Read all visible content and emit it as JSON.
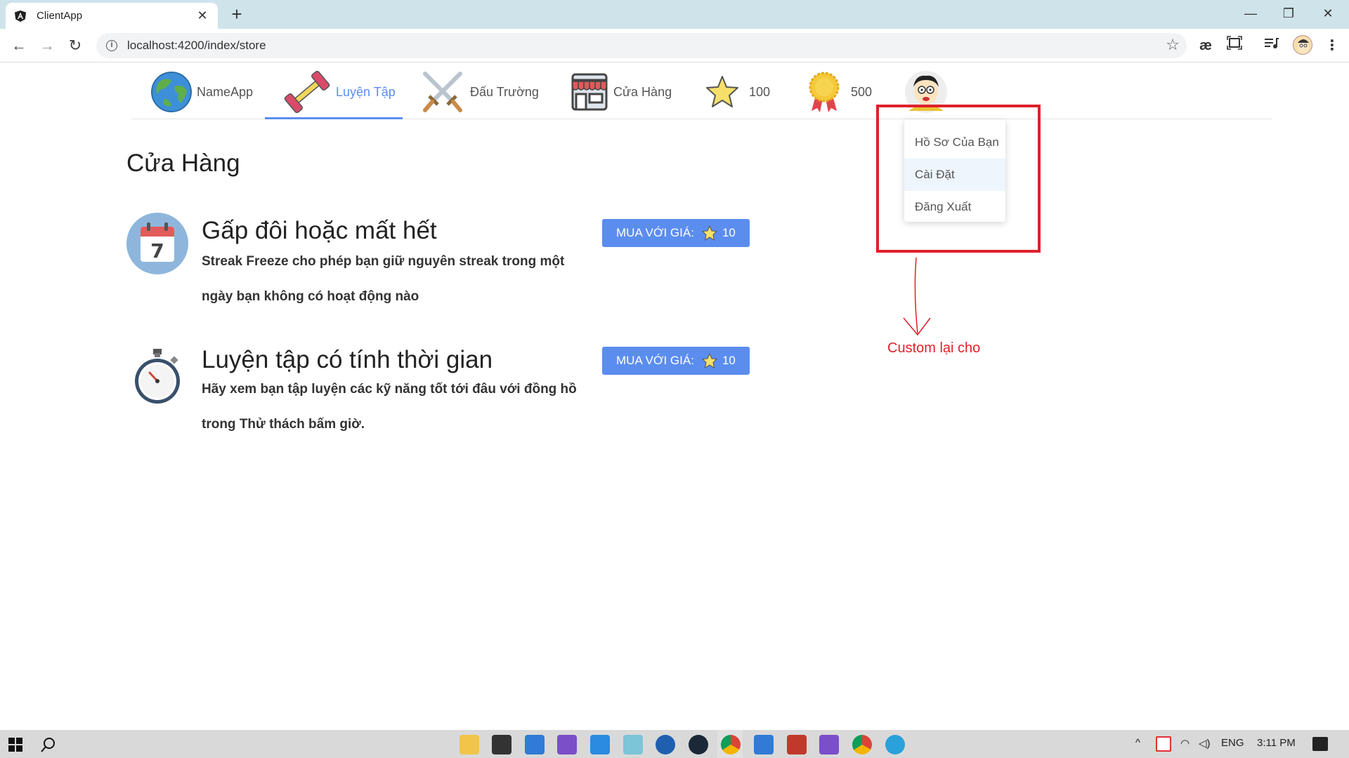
{
  "browser": {
    "tab_title": "ClientApp",
    "tab_close": "✕",
    "new_tab": "+",
    "url": "localhost:4200/index/store",
    "win_min": "—",
    "win_max": "❐",
    "win_close": "✕",
    "back": "←",
    "forward": "→",
    "reload": "↻",
    "star": "☆",
    "ext_text": "æ"
  },
  "nav": {
    "items": [
      {
        "label": "NameApp",
        "icon": "globe-icon"
      },
      {
        "label": "Luyện Tập",
        "icon": "dumbbell-icon",
        "active": true
      },
      {
        "label": "Đấu Trường",
        "icon": "crossed-swords-icon"
      },
      {
        "label": "Cửa Hàng",
        "icon": "store-icon"
      }
    ],
    "stars": "100",
    "medals": "500",
    "avatar": "user-avatar"
  },
  "dropdown": {
    "items": [
      "Hồ Sơ Của Bạn",
      "Cài Đặt",
      "Đăng Xuất"
    ],
    "hovered": "Cài Đặt"
  },
  "annotation": {
    "text": "Custom lại cho",
    "color": "#e0202a"
  },
  "store": {
    "title": "Cửa Hàng",
    "items": [
      {
        "title": "Gấp đôi hoặc mất hết",
        "description": "Streak Freeze cho phép bạn giữ nguyên streak trong một ngày bạn không có hoạt động nào",
        "button_label": "MUA VỚI GIÁ:",
        "price": "10",
        "icon": "calendar-icon"
      },
      {
        "title": "Luyện tập có tính thời gian",
        "description": "Hãy xem bạn tập luyện các kỹ năng tốt tới đâu với đồng hồ trong Thử thách bấm giờ.",
        "button_label": "MUA VỚI GIÁ:",
        "price": "10",
        "icon": "stopwatch-icon"
      }
    ]
  },
  "taskbar": {
    "lang": "ENG",
    "time": "3:11 PM"
  },
  "colors": {
    "accent": "#5b8def",
    "titlebar": "#cfe3ea"
  }
}
